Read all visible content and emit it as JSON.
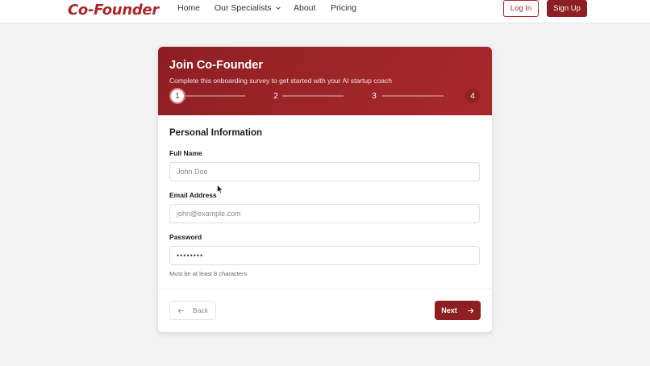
{
  "brand": {
    "logo_text": "Co-Founder",
    "accent": "#8d1f22",
    "logo_color": "#a8282a"
  },
  "nav": {
    "links": [
      "Home",
      "Our Specialists",
      "About",
      "Pricing"
    ],
    "specialists_icon": "chevron-down-icon",
    "login_label": "Log In",
    "signup_label": "Sign Up"
  },
  "card": {
    "title": "Join Co-Founder",
    "subtitle": "Complete this onboarding survey to get started with your AI startup coach",
    "steps": [
      "1",
      "2",
      "3",
      "4"
    ],
    "current_step": 1,
    "section_title": "Personal Information",
    "fields": {
      "full_name": {
        "label": "Full Name",
        "placeholder": "John Doe",
        "value": ""
      },
      "email": {
        "label": "Email Address",
        "placeholder": "john@example.com",
        "value": ""
      },
      "password": {
        "label": "Password",
        "value": "••••••••",
        "hint": "Must be at least 8 characters"
      }
    },
    "back_label": "Back",
    "back_icon": "arrow-left-icon",
    "next_label": "Next",
    "next_icon": "arrow-right-icon"
  }
}
